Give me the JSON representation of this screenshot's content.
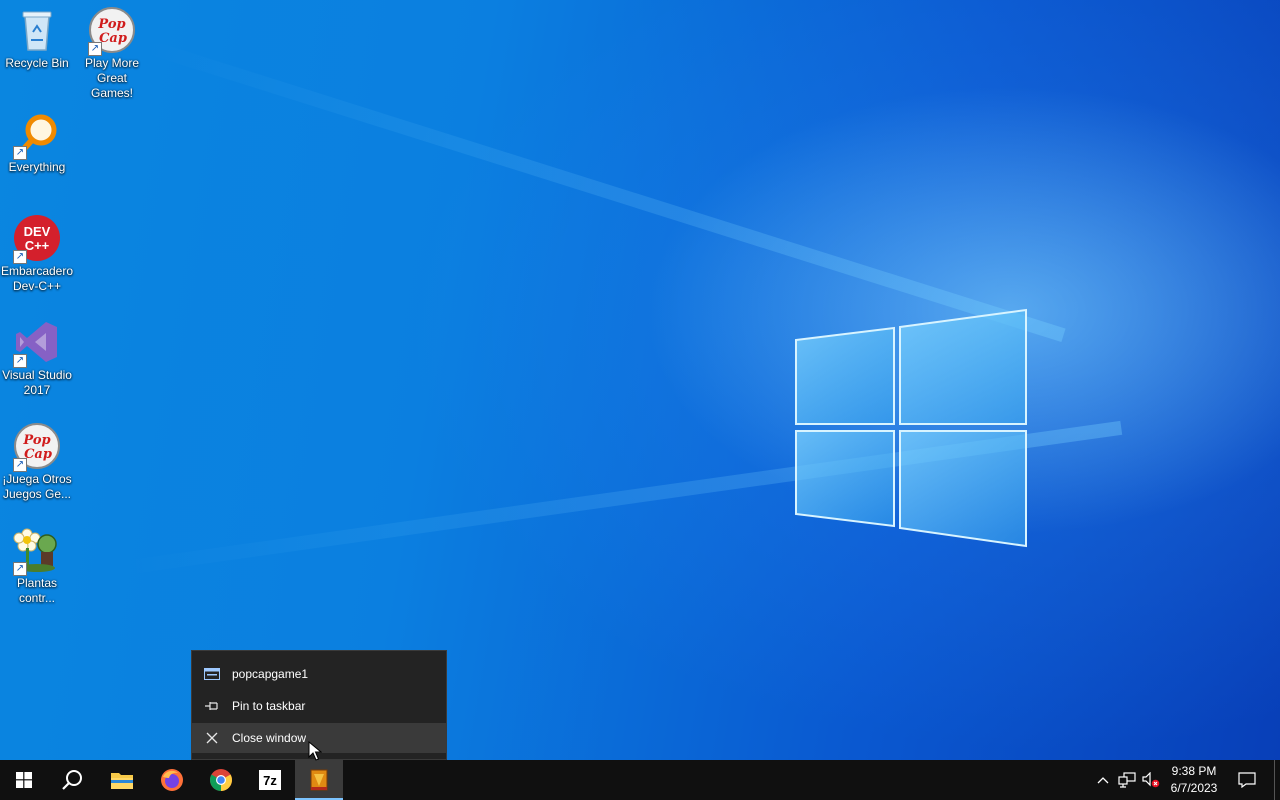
{
  "desktop": {
    "icons": [
      {
        "label": "Recycle Bin",
        "icon": "recycle-bin-icon",
        "shortcut": false
      },
      {
        "label": "Play More Great Games!",
        "icon": "popcap-icon",
        "shortcut": true
      },
      {
        "label": "Everything",
        "icon": "everything-search-icon",
        "shortcut": true
      },
      {
        "label": "Embarcadero Dev-C++",
        "icon": "devcpp-icon",
        "shortcut": true
      },
      {
        "label": "Visual Studio 2017",
        "icon": "visual-studio-icon",
        "shortcut": true
      },
      {
        "label": "¡Juega Otros Juegos Ge...",
        "icon": "popcap-icon",
        "shortcut": true
      },
      {
        "label": "Plantas contr...",
        "icon": "plants-vs-zombies-icon",
        "shortcut": true
      }
    ],
    "popcap_logo_text": [
      "Pop",
      "Cap"
    ],
    "devcpp_logo_text": [
      "DEV",
      "C++"
    ]
  },
  "jumplist": {
    "items": [
      {
        "label": "popcapgame1",
        "icon": "app-window-icon"
      },
      {
        "label": "Pin to taskbar",
        "icon": "pin-icon"
      },
      {
        "label": "Close window",
        "icon": "close-icon",
        "hovered": true
      }
    ]
  },
  "taskbar": {
    "buttons": [
      {
        "name": "start",
        "icon": "windows-start-icon"
      },
      {
        "name": "search",
        "icon": "search-icon"
      },
      {
        "name": "file-explorer",
        "icon": "folder-icon"
      },
      {
        "name": "firefox",
        "icon": "firefox-icon"
      },
      {
        "name": "chrome",
        "icon": "chrome-icon"
      },
      {
        "name": "7zip",
        "icon": "7zip-icon",
        "text": "7z"
      },
      {
        "name": "popcapgame1",
        "icon": "popcap-game-icon",
        "active": true
      }
    ],
    "tray": {
      "icons": [
        "chevron-up-icon",
        "network-icon",
        "volume-muted-icon",
        "notifications-icon"
      ],
      "time": "9:38 PM",
      "date": "6/7/2023"
    }
  },
  "colors": {
    "taskbar_bg": "#101010",
    "menu_bg": "#232323",
    "accent_underline": "#7cc4ff"
  }
}
